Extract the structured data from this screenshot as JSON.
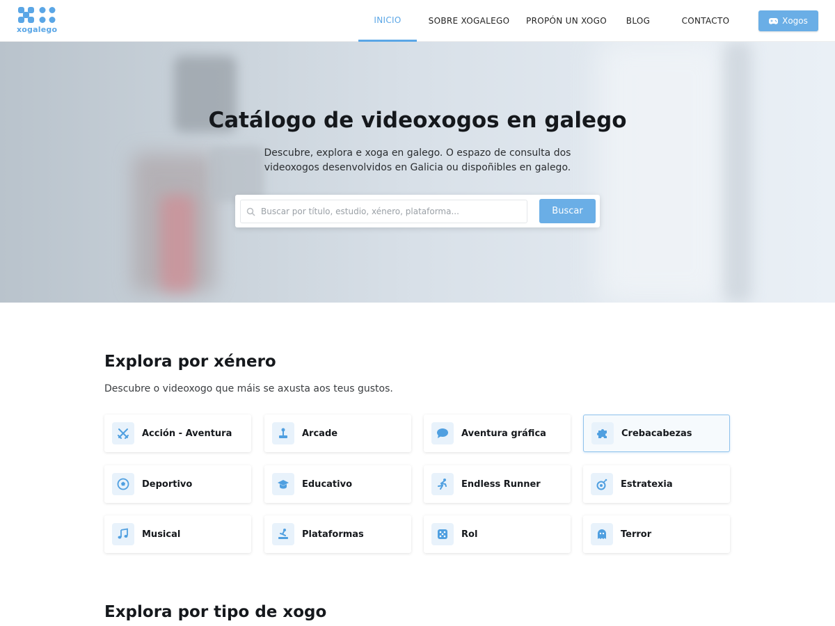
{
  "header": {
    "logo_text": "xogalego",
    "nav": [
      {
        "label": "INICIO",
        "active": true
      },
      {
        "label": "SOBRE XOGALEGO",
        "active": false
      },
      {
        "label": "PROPÓN UN XOGO",
        "active": false
      },
      {
        "label": "BLOG",
        "active": false
      },
      {
        "label": "CONTACTO",
        "active": false
      }
    ],
    "cta_label": "Xogos",
    "cta_icon": "gamepad-icon"
  },
  "hero": {
    "title": "Catálogo de videoxogos en galego",
    "subtitle": "Descubre, explora e xoga en galego. O espazo de consulta dos videoxogos desenvolvidos en Galicia ou dispoñibles en galego.",
    "search": {
      "placeholder": "Buscar por título, estudio, xénero, plataforma...",
      "value": "",
      "button_label": "Buscar"
    }
  },
  "genres": {
    "title": "Explora por xénero",
    "subtitle": "Descubre o videoxogo que máis se axusta aos teus gustos.",
    "items": [
      {
        "label": "Acción - Aventura",
        "icon": "swords-icon"
      },
      {
        "label": "Arcade",
        "icon": "joystick-icon"
      },
      {
        "label": "Aventura gráfica",
        "icon": "speech-bubble-icon"
      },
      {
        "label": "Crebacabezas",
        "icon": "puzzle-icon",
        "selected": true
      },
      {
        "label": "Deportivo",
        "icon": "soccer-ball-icon"
      },
      {
        "label": "Educativo",
        "icon": "graduation-cap-icon"
      },
      {
        "label": "Endless Runner",
        "icon": "runner-icon"
      },
      {
        "label": "Estratexia",
        "icon": "bomb-icon"
      },
      {
        "label": "Musical",
        "icon": "music-note-icon"
      },
      {
        "label": "Plataformas",
        "icon": "platform-jumper-icon"
      },
      {
        "label": "Rol",
        "icon": "dice-icon"
      },
      {
        "label": "Terror",
        "icon": "ghost-icon"
      }
    ]
  },
  "types": {
    "title": "Explora por tipo de xogo"
  },
  "colors": {
    "accent": "#5aa6e6",
    "button": "#6aaee6",
    "icon_bg": "#e8f2fb"
  }
}
